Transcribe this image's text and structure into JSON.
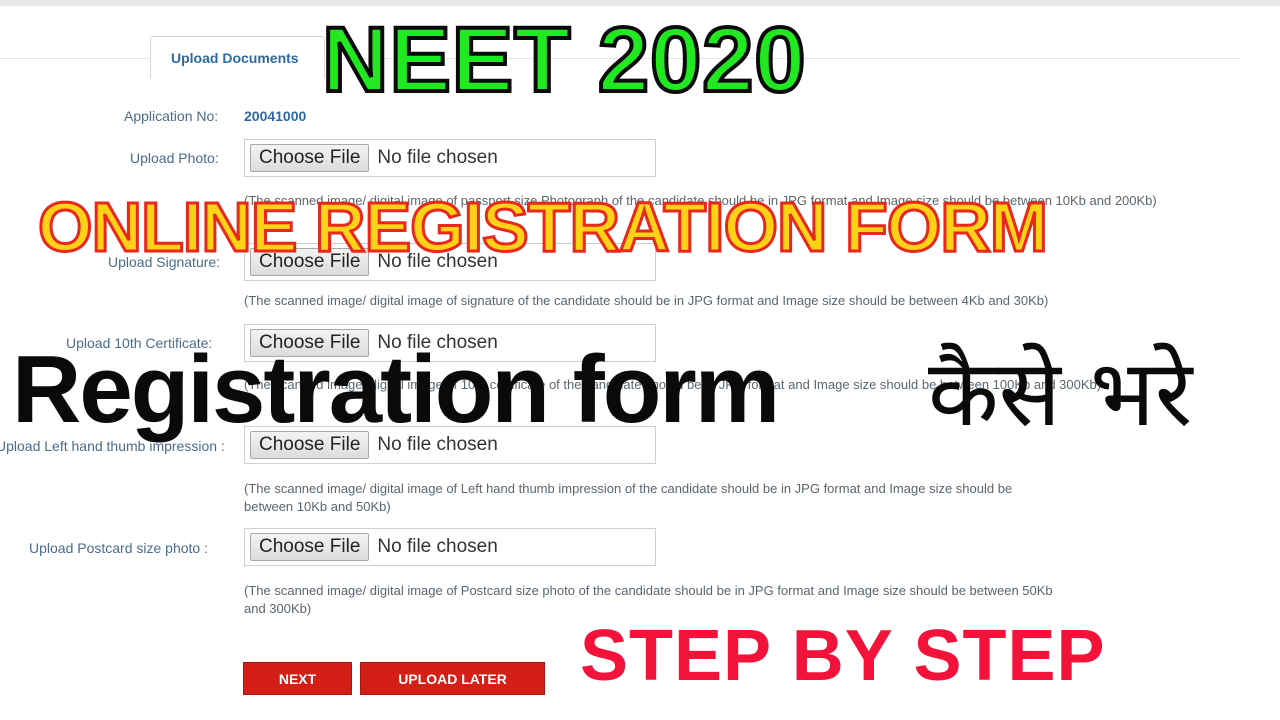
{
  "tab": {
    "label": "Upload Documents"
  },
  "application": {
    "label": "Application No:",
    "value": "20041000"
  },
  "fields": [
    {
      "label": "Upload Photo:",
      "button": "Choose File",
      "status": "No file chosen",
      "hint": "(The scanned image/ digital image of passport size Photograph of the candidate should be in JPG format and Image size should be between 10Kb and 200Kb)"
    },
    {
      "label": "Upload Signature:",
      "button": "Choose File",
      "status": "No file chosen",
      "hint": "(The scanned image/ digital image of signature of the candidate should be in JPG format and Image size should be between 4Kb and 30Kb)"
    },
    {
      "label": "Upload 10th Certificate:",
      "button": "Choose File",
      "status": "No file chosen",
      "hint": "(The scanned image/ digital image of 10th certificate of the candidate should be in JPG format and Image size should be between 100Kb and 300Kb)"
    },
    {
      "label": "Upload Left hand thumb impression :",
      "button": "Choose File",
      "status": "No file chosen",
      "hint_line1": "(The scanned image/ digital image of Left hand thumb impression of the candidate should be in JPG format and Image size should be",
      "hint_line2": "between 10Kb and 50Kb)"
    },
    {
      "label": "Upload Postcard size photo :",
      "button": "Choose File",
      "status": "No file chosen",
      "hint_line1": "(The scanned image/ digital image of Postcard size photo of the candidate should be in JPG format and Image size should be between 50Kb",
      "hint_line2": "and 300Kb)"
    }
  ],
  "buttons": {
    "next": "NEXT",
    "upload_later": "UPLOAD LATER"
  },
  "overlay": {
    "neet": "NEET 2020",
    "online": "ONLINE REGISTRATION FORM",
    "registration": "Registration form",
    "hindi": "कैसे भरे",
    "step": "STEP BY STEP"
  },
  "colors": {
    "neet": "#21e821",
    "online_fill": "#ffd218",
    "online_stroke": "#e8271d",
    "step": "#f31239",
    "button_red": "#d51f16",
    "link_blue": "#2d6aa3"
  }
}
